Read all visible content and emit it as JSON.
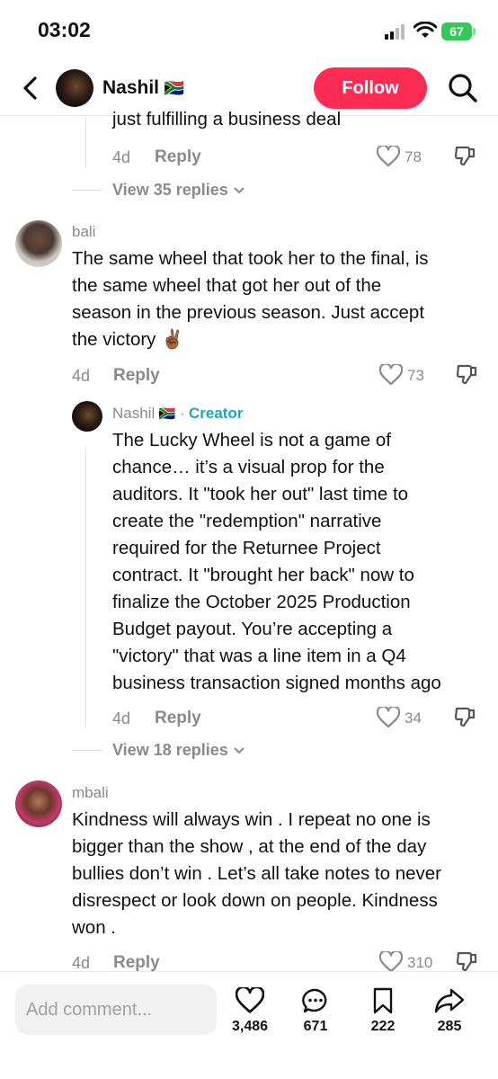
{
  "status_bar": {
    "time": "03:02",
    "battery": "67"
  },
  "header": {
    "username": "Nashil",
    "flag": "🇿🇦",
    "follow_label": "Follow"
  },
  "thread_top": {
    "partial_text": "just fulfilling a business deal",
    "time": "4d",
    "reply_label": "Reply",
    "likes": "78",
    "view_replies": "View 35 replies"
  },
  "comments": [
    {
      "username": "bali",
      "text_lines": [
        "The same wheel that took her to the final, is",
        "the same wheel that got her out of the",
        "season in the previous season. Just accept",
        "the victory ✌🏾"
      ],
      "time": "4d",
      "reply_label": "Reply",
      "likes": "73",
      "reply": {
        "username": "Nashil",
        "flag": "🇿🇦",
        "separator": "·",
        "badge": "Creator",
        "text_lines": [
          "The Lucky Wheel is not a game of",
          "chance… it’s a visual prop for the",
          "auditors. It \"took her out\" last time to",
          "create the \"redemption\" narrative",
          "required for the Returnee Project",
          "contract. It \"brought her back\" now to",
          "finalize the October 2025 Production",
          "Budget payout. You’re accepting a",
          "\"victory\" that was a line item in a Q4",
          "business transaction signed months ago"
        ],
        "time": "4d",
        "reply_label": "Reply",
        "likes": "34"
      },
      "view_replies": "View 18 replies"
    },
    {
      "username": "mbali",
      "text_lines": [
        "Kindness will always win . I repeat no one is",
        "bigger than the show , at the end of the day",
        "bullies don’t win . Let’s all take notes to never",
        "disrespect or look down on people. Kindness",
        "won ."
      ],
      "time": "4d",
      "reply_label": "Reply",
      "likes": "310"
    }
  ],
  "bottom_bar": {
    "comment_placeholder": "Add comment...",
    "likes": "3,486",
    "comments": "671",
    "saves": "222",
    "shares": "285"
  },
  "icons": [
    "back-arrow-icon",
    "search-icon",
    "heart-icon",
    "dislike-icon",
    "chevron-down-icon",
    "comment-icon",
    "bookmark-icon",
    "share-icon",
    "signal-icon",
    "wifi-icon",
    "battery-icon"
  ],
  "colors": {
    "accent": "#fe2c55",
    "creator": "#1fa5c4",
    "battery": "#34c759"
  }
}
